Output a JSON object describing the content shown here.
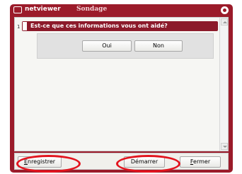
{
  "window": {
    "app_name": "netviewer",
    "title": "Sondage"
  },
  "survey": {
    "question_number": "1",
    "question": "Est-ce que ces informations vous ont aidé?",
    "answers": {
      "yes": "Oui",
      "no": "Non"
    }
  },
  "footer": {
    "save": {
      "mnemonic": "E",
      "rest": "nregistrer"
    },
    "start": "Démarrer",
    "close": {
      "mnemonic": "F",
      "rest": "ermer"
    }
  },
  "colors": {
    "accent": "#9b1b2a",
    "highlight_oval": "#e3141e"
  }
}
